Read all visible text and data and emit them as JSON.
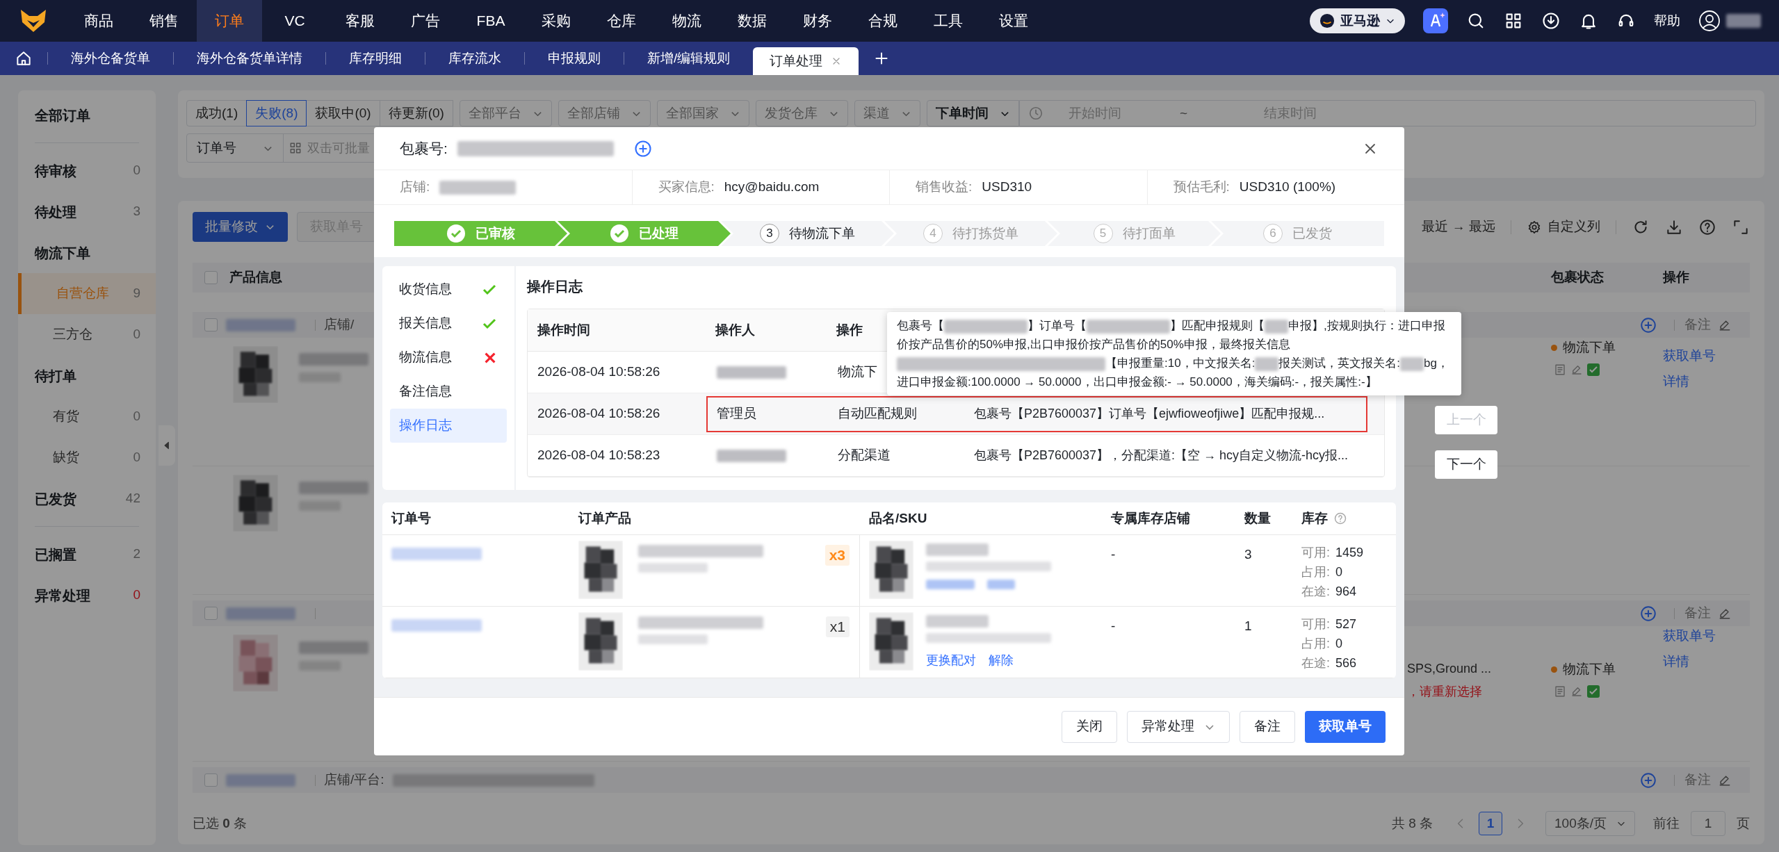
{
  "top_nav": {
    "menu": [
      {
        "label": "商品",
        "selected": false
      },
      {
        "label": "销售",
        "selected": false
      },
      {
        "label": "订单",
        "selected": true
      },
      {
        "label": "VC",
        "selected": false
      },
      {
        "label": "客服",
        "selected": false
      },
      {
        "label": "广告",
        "selected": false
      },
      {
        "label": "FBA",
        "selected": false
      },
      {
        "label": "采购",
        "selected": false
      },
      {
        "label": "仓库",
        "selected": false
      },
      {
        "label": "物流",
        "selected": false
      },
      {
        "label": "数据",
        "selected": false
      },
      {
        "label": "财务",
        "selected": false
      },
      {
        "label": "合规",
        "selected": false
      },
      {
        "label": "工具",
        "selected": false
      },
      {
        "label": "设置",
        "selected": false
      }
    ],
    "platform": "亚马逊",
    "help": "帮助"
  },
  "tabs": [
    {
      "label": "海外仓备货单",
      "selected": false,
      "closable": false
    },
    {
      "label": "海外仓备货单详情",
      "selected": false,
      "closable": false
    },
    {
      "label": "库存明细",
      "selected": false,
      "closable": false
    },
    {
      "label": "库存流水",
      "selected": false,
      "closable": false
    },
    {
      "label": "申报规则",
      "selected": false,
      "closable": false
    },
    {
      "label": "新增/编辑规则",
      "selected": false,
      "closable": false
    },
    {
      "label": "订单处理",
      "selected": true,
      "closable": true
    }
  ],
  "sidebar": {
    "sections": [
      {
        "items": [
          {
            "label": "全部订单",
            "kind": "header",
            "selected": false
          }
        ]
      },
      {
        "items": [
          {
            "label": "待审核",
            "count": "0",
            "kind": "header",
            "selected": false,
            "alert": false
          },
          {
            "label": "待处理",
            "count": "3",
            "kind": "header",
            "selected": false,
            "alert": false
          },
          {
            "label": "物流下单",
            "kind": "header",
            "selected": false
          },
          {
            "label": "自营仓库",
            "count": "9",
            "kind": "sub",
            "selected": true,
            "alert": false
          },
          {
            "label": "三方仓",
            "count": "0",
            "kind": "sub",
            "selected": false,
            "alert": false
          },
          {
            "label": "待打单",
            "kind": "header",
            "selected": false
          },
          {
            "label": "有货",
            "count": "0",
            "kind": "sub",
            "selected": false,
            "alert": false
          },
          {
            "label": "缺货",
            "count": "0",
            "kind": "sub",
            "selected": false,
            "alert": false
          },
          {
            "label": "已发货",
            "count": "42",
            "kind": "header",
            "selected": false,
            "alert": false
          }
        ]
      },
      {
        "items": [
          {
            "label": "已搁置",
            "count": "2",
            "kind": "header",
            "selected": false,
            "alert": false
          },
          {
            "label": "异常处理",
            "count": "0",
            "kind": "header",
            "selected": false,
            "alert": true
          }
        ]
      }
    ]
  },
  "filters": {
    "status_tabs": [
      {
        "label": "成功(1)",
        "selected": false
      },
      {
        "label": "失败(8)",
        "selected": true
      },
      {
        "label": "获取中(0)",
        "selected": false
      },
      {
        "label": "待更新(0)",
        "selected": false
      }
    ],
    "dropdowns": [
      "全部平台",
      "全部店铺",
      "全部国家",
      "发货仓库",
      "渠道"
    ],
    "time_type": "下单时间",
    "start_placeholder": "开始时间",
    "range_separator": "~",
    "end_placeholder": "结束时间",
    "search_type": "订单号",
    "search_placeholder": "双击可批量"
  },
  "orders": {
    "toolbar": {
      "batch_edit": "批量修改",
      "fetch": "获取单号",
      "sort": "最近 → 最远",
      "custom_columns": "自定义列"
    },
    "columns": {
      "product": "产品信息",
      "status": "包裹状态",
      "actions": "操作"
    },
    "select_all_checked": false,
    "groups": [
      {
        "checked": false,
        "store_label": "店铺/",
        "note": "备注",
        "rows": [
          {
            "kind": "full",
            "status": "物流下单",
            "actions": [
              "获取单号",
              "详情"
            ]
          },
          {
            "kind": "image_only"
          }
        ]
      },
      {
        "checked": false,
        "note": "备注",
        "rows": [
          {
            "kind": "full",
            "channel": "SPS,Ground ...",
            "channel_error": "，请重新选择",
            "status": "物流下单",
            "actions": [
              "获取单号",
              "详情"
            ]
          }
        ]
      },
      {
        "checked": false,
        "store_label": "店铺/平台:",
        "note": "备注"
      }
    ],
    "pagination": {
      "selected_count": "已选 **0** 条",
      "total": "共 8 条",
      "page": "1",
      "page_size": "100条/页",
      "goto_label": "前往",
      "goto_value": "1",
      "goto_suffix": "页"
    }
  },
  "modal": {
    "package_label": "包裹号:",
    "info": [
      {
        "label": "店铺:",
        "blurred": true
      },
      {
        "label": "买家信息:",
        "value": "hcy@baidu.com",
        "blurred": false
      },
      {
        "label": "销售收益:",
        "value": "USD310",
        "blurred": false
      },
      {
        "label": "预估毛利:",
        "value": "USD310 (100%)",
        "blurred": false
      }
    ],
    "steps": [
      {
        "label": "已审核",
        "kind": "done"
      },
      {
        "label": "已处理",
        "kind": "done"
      },
      {
        "label": "待物流下单",
        "number": "3",
        "kind": "current"
      },
      {
        "label": "待打拣货单",
        "number": "4",
        "kind": "pending"
      },
      {
        "label": "待打面单",
        "number": "5",
        "kind": "pending"
      },
      {
        "label": "已发货",
        "number": "6",
        "kind": "pending"
      }
    ],
    "nav": [
      {
        "label": "收货信息",
        "kind": "ok",
        "selected": false
      },
      {
        "label": "报关信息",
        "kind": "ok",
        "selected": false
      },
      {
        "label": "物流信息",
        "kind": "error",
        "selected": false
      },
      {
        "label": "备注信息",
        "kind": "none",
        "selected": false
      },
      {
        "label": "操作日志",
        "kind": "none",
        "selected": true
      }
    ],
    "log": {
      "title": "操作日志",
      "columns": [
        "操作时间",
        "操作人",
        "操作"
      ],
      "rows": [
        {
          "time": "2026-08-04 10:58:26",
          "operator_blurred": true,
          "operation": "物流下",
          "highlighted": false
        },
        {
          "time": "2026-08-04 10:58:26",
          "operator": "管理员",
          "operator_blurred": false,
          "operation": "自动匹配规则",
          "detail": "包裹号【P2B7600037】订单号【ejwfioweofjiwe】匹配申报规...",
          "highlighted": true
        },
        {
          "time": "2026-08-04 10:58:23",
          "operator_blurred": true,
          "operation": "分配渠道",
          "detail": "包裹号【P2B7600037】，分配渠道:【空 → hcy自定义物流-hcy报...",
          "highlighted": false
        }
      ],
      "tooltip": {
        "segments": [
          {
            "kind": "text",
            "text": "包裹号【"
          },
          {
            "kind": "blur_long"
          },
          {
            "kind": "text",
            "text": "】订单号【"
          },
          {
            "kind": "blur_long"
          },
          {
            "kind": "text",
            "text": "】匹配申报规则【"
          },
          {
            "kind": "blur_short"
          },
          {
            "kind": "text",
            "text": "申报】,按规则执行：进口申报价按产品售价的50%申报,出口申报价按产品售价的50%申报，最终报关信息"
          },
          {
            "kind": "blur_wide"
          },
          {
            "kind": "text",
            "text": "【申报重量:10，中文报关名:"
          },
          {
            "kind": "blur_short"
          },
          {
            "kind": "text",
            "text": "报关测试，英文报关名:"
          },
          {
            "kind": "blur_short"
          },
          {
            "kind": "text",
            "text": "bg，进口申报金额:100.0000 → 50.0000，出口申报金额:- → 50.0000，海关编码:-，报关属性:-】"
          }
        ]
      }
    },
    "items": {
      "columns": [
        "订单号",
        "订单产品",
        "品名/SKU",
        "专属库存店铺",
        "数量",
        "库存"
      ],
      "rows": [
        {
          "qty_badge": "x3",
          "badge_highlight": true,
          "store": "-",
          "quantity": "3",
          "links_blurred": true,
          "stock": [
            {
              "label": "可用:",
              "value": "1459"
            },
            {
              "label": "占用:",
              "value": "0"
            },
            {
              "label": "在途:",
              "value": "964"
            }
          ]
        },
        {
          "qty_badge": "x1",
          "badge_highlight": false,
          "store": "-",
          "quantity": "1",
          "links_blurred": false,
          "links": [
            "更换配对",
            "解除"
          ],
          "stock": [
            {
              "label": "可用:",
              "value": "527"
            },
            {
              "label": "占用:",
              "value": "0"
            },
            {
              "label": "在途:",
              "value": "566"
            }
          ]
        }
      ]
    },
    "footer": [
      {
        "label": "关闭",
        "kind": "default"
      },
      {
        "label": "异常处理",
        "kind": "dropdown"
      },
      {
        "label": "备注",
        "kind": "default"
      },
      {
        "label": "获取单号",
        "kind": "primary"
      }
    ]
  },
  "pager_buttons": [
    {
      "label": "上一个",
      "disabled": true
    },
    {
      "label": "下一个",
      "disabled": false
    }
  ]
}
